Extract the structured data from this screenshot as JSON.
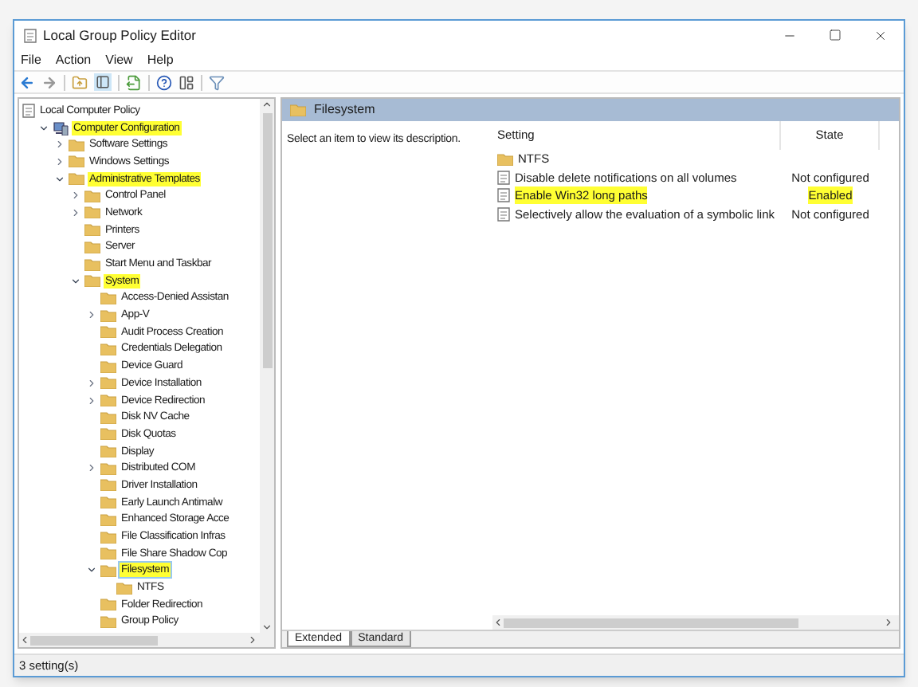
{
  "window": {
    "title": "Local Group Policy Editor"
  },
  "menu": [
    "File",
    "Action",
    "View",
    "Help"
  ],
  "tree": [
    {
      "label": "Local Computer Policy",
      "kind": "policy",
      "highlighted": false,
      "selected": false,
      "children": [
        {
          "label": "Computer Configuration",
          "kind": "computer",
          "expanded": true,
          "highlighted": true,
          "selected": false,
          "children": [
            {
              "label": "Software Settings",
              "kind": "folder",
              "expanded": false,
              "highlighted": false,
              "selected": false
            },
            {
              "label": "Windows Settings",
              "kind": "folder",
              "expanded": false,
              "highlighted": false,
              "selected": false
            },
            {
              "label": "Administrative Templates",
              "kind": "folder",
              "expanded": true,
              "highlighted": true,
              "selected": false,
              "children": [
                {
                  "label": "Control Panel",
                  "kind": "folder",
                  "expanded": false,
                  "highlighted": false,
                  "selected": false
                },
                {
                  "label": "Network",
                  "kind": "folder",
                  "expanded": false,
                  "highlighted": false,
                  "selected": false
                },
                {
                  "label": "Printers",
                  "kind": "folder",
                  "highlighted": false,
                  "selected": false
                },
                {
                  "label": "Server",
                  "kind": "folder",
                  "highlighted": false,
                  "selected": false
                },
                {
                  "label": "Start Menu and Taskbar",
                  "kind": "folder",
                  "highlighted": false,
                  "selected": false
                },
                {
                  "label": "System",
                  "kind": "folder",
                  "expanded": true,
                  "highlighted": true,
                  "selected": false,
                  "children": [
                    {
                      "label": "Access-Denied Assistan",
                      "kind": "folder",
                      "highlighted": false,
                      "selected": false
                    },
                    {
                      "label": "App-V",
                      "kind": "folder",
                      "expanded": false,
                      "highlighted": false,
                      "selected": false
                    },
                    {
                      "label": "Audit Process Creation",
                      "kind": "folder",
                      "highlighted": false,
                      "selected": false
                    },
                    {
                      "label": "Credentials Delegation",
                      "kind": "folder",
                      "highlighted": false,
                      "selected": false
                    },
                    {
                      "label": "Device Guard",
                      "kind": "folder",
                      "highlighted": false,
                      "selected": false
                    },
                    {
                      "label": "Device Installation",
                      "kind": "folder",
                      "expanded": false,
                      "highlighted": false,
                      "selected": false
                    },
                    {
                      "label": "Device Redirection",
                      "kind": "folder",
                      "expanded": false,
                      "highlighted": false,
                      "selected": false
                    },
                    {
                      "label": "Disk NV Cache",
                      "kind": "folder",
                      "highlighted": false,
                      "selected": false
                    },
                    {
                      "label": "Disk Quotas",
                      "kind": "folder",
                      "highlighted": false,
                      "selected": false
                    },
                    {
                      "label": "Display",
                      "kind": "folder",
                      "highlighted": false,
                      "selected": false
                    },
                    {
                      "label": "Distributed COM",
                      "kind": "folder",
                      "expanded": false,
                      "highlighted": false,
                      "selected": false
                    },
                    {
                      "label": "Driver Installation",
                      "kind": "folder",
                      "highlighted": false,
                      "selected": false
                    },
                    {
                      "label": "Early Launch Antimalw",
                      "kind": "folder",
                      "highlighted": false,
                      "selected": false
                    },
                    {
                      "label": "Enhanced Storage Acce",
                      "kind": "folder",
                      "highlighted": false,
                      "selected": false
                    },
                    {
                      "label": "File Classification Infras",
                      "kind": "folder",
                      "highlighted": false,
                      "selected": false
                    },
                    {
                      "label": "File Share Shadow Cop",
                      "kind": "folder",
                      "highlighted": false,
                      "selected": false
                    },
                    {
                      "label": "Filesystem",
                      "kind": "folder",
                      "expanded": true,
                      "highlighted": true,
                      "selected": true,
                      "children": [
                        {
                          "label": "NTFS",
                          "kind": "folder",
                          "highlighted": false,
                          "selected": false
                        }
                      ]
                    },
                    {
                      "label": "Folder Redirection",
                      "kind": "folder",
                      "highlighted": false,
                      "selected": false
                    },
                    {
                      "label": "Group Policy",
                      "kind": "folder",
                      "highlighted": false,
                      "selected": false
                    }
                  ]
                }
              ]
            }
          ]
        }
      ]
    }
  ],
  "details": {
    "header": "Filesystem",
    "description": "Select an item to view its description.",
    "columns": [
      "Setting",
      "State"
    ],
    "rows": [
      {
        "kind": "folder",
        "setting": "NTFS",
        "highlighted": false
      },
      {
        "kind": "policy",
        "setting": "Disable delete notifications on all volumes",
        "state": "Not configured",
        "highlighted": false
      },
      {
        "kind": "policy",
        "setting": "Enable Win32 long paths",
        "state": "Enabled",
        "highlighted": true
      },
      {
        "kind": "policy",
        "setting": "Selectively allow the evaluation of a symbolic link",
        "state": "Not configured",
        "highlighted": false
      }
    ],
    "tabs": [
      {
        "label": "Extended",
        "selected": true
      },
      {
        "label": "Standard",
        "selected": false
      }
    ]
  },
  "status_bar": {
    "text": "3 setting(s)"
  }
}
